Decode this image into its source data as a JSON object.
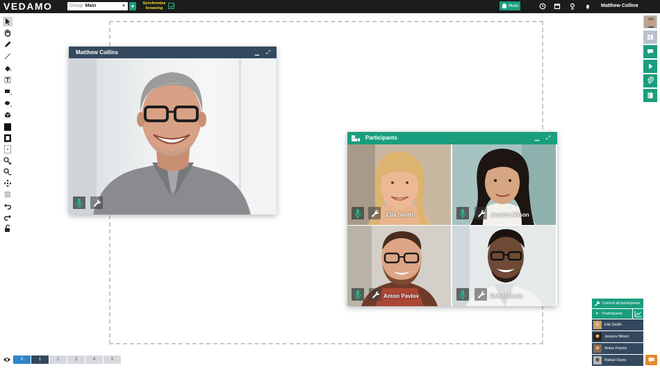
{
  "topbar": {
    "logo": "VEDAMO",
    "group_label": "Group",
    "group_value": "Main",
    "group_add_label": "+",
    "sync_label": "Synchronise browsing",
    "mute_label": "Mute",
    "user_name": "Matthew Collins"
  },
  "video_window": {
    "title": "Matthew Collins"
  },
  "participants_window": {
    "title": "Participants",
    "tiles": [
      {
        "name": "Ella Smith"
      },
      {
        "name": "Jessica Nilson"
      },
      {
        "name": "Anton Pavlov"
      },
      {
        "name": "Rafael Davis"
      }
    ]
  },
  "participant_list": {
    "control_all_label": "Control all participants",
    "header_label": "Participants",
    "items": [
      {
        "name": "Ella Smith"
      },
      {
        "name": "Jessica Nilson"
      },
      {
        "name": "Anton Pavlov"
      },
      {
        "name": "Rafael Davis"
      }
    ]
  },
  "pages": {
    "current_label": "0",
    "items": [
      "1",
      "2",
      "3",
      "4",
      "5"
    ]
  },
  "colors": {
    "topbar": "#1c1c1c",
    "accent": "#1a9e7e",
    "window_header": "#34495e",
    "current_page": "#2d86c6",
    "chat": "#e38a2c"
  }
}
